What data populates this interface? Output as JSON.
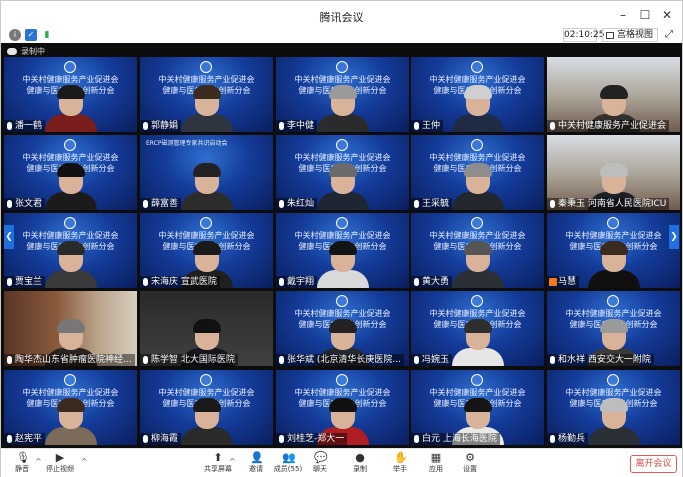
{
  "window": {
    "title": "腾讯会议",
    "minimize": "–",
    "maximize": "☐",
    "close": "✕"
  },
  "toolbar": {
    "timer": "02:10:25",
    "view_label": "宫格视图",
    "view_caret": "▾",
    "fullscreen": "⤢"
  },
  "recording": {
    "label": "录制中"
  },
  "banner": {
    "line1": "中关村健康服务产业促进会",
    "line2": "健康与医疗科技创新分会",
    "alt_line1": "ERCP磁测管理专家共识启动会"
  },
  "participants": [
    {
      "name": "潘一鹤",
      "bg": "blue",
      "hair": "#1a1a1a",
      "shirt": "#7a1d1d"
    },
    {
      "name": "郭静娟",
      "bg": "blue",
      "hair": "#3a2a1f",
      "shirt": "#2e3440"
    },
    {
      "name": "李中健",
      "bg": "blue",
      "hair": "#9a9a9a",
      "shirt": "#2b2b2b"
    },
    {
      "name": "王仲",
      "bg": "blue",
      "hair": "#cfcfcf",
      "shirt": "#1f2a44"
    },
    {
      "name": "中关村健康服务产业促进会",
      "bg": "room",
      "hair": "#222",
      "shirt": "#34302c"
    },
    {
      "name": "张文君",
      "bg": "blue",
      "hair": "#111111",
      "shirt": "#1b1b1b"
    },
    {
      "name": "薛富善",
      "bg": "blue-alt",
      "hair": "#222222",
      "shirt": "#2c2c2c"
    },
    {
      "name": "朱红灿",
      "bg": "blue",
      "hair": "#6b6b6b",
      "shirt": "#1e2533"
    },
    {
      "name": "王采毓",
      "bg": "blue",
      "hair": "#8d8d8d",
      "shirt": "#23262d"
    },
    {
      "name": "秦秉玉 河南省人民医院ICU",
      "bg": "room",
      "hair": "#bdbdbd",
      "shirt": "#1d2027"
    },
    {
      "name": "贾宝兰",
      "bg": "blue",
      "hair": "#2a2a2a",
      "shirt": "#3a3a3a"
    },
    {
      "name": "宋海庆 宣武医院",
      "bg": "blue",
      "hair": "#1a1a1a",
      "shirt": "#202020"
    },
    {
      "name": "戴宇翔",
      "bg": "blue",
      "hair": "#141414",
      "shirt": "#d9d9d9"
    },
    {
      "name": "黄大勇",
      "bg": "blue",
      "hair": "#555555",
      "shirt": "#2b2f36"
    },
    {
      "name": "马慧",
      "bg": "blue",
      "hair": "#3b2a1e",
      "shirt": "#101010"
    },
    {
      "name": "陶华杰山东省肿瘤医院神经...",
      "bg": "shelf",
      "hair": "#777777",
      "shirt": "#2a2320"
    },
    {
      "name": "陈学智 北大国际医院",
      "bg": "dark",
      "hair": "#111111",
      "shirt": "#15171c"
    },
    {
      "name": "张华斌 (北京清华长庚医院...",
      "bg": "blue",
      "hair": "#222222",
      "shirt": "#23272f"
    },
    {
      "name": "冯婉玉",
      "bg": "blue",
      "hair": "#2e2e2e",
      "shirt": "#e6e6e6"
    },
    {
      "name": "和水祥 西安交大一附院",
      "bg": "blue",
      "hair": "#9a9a9a",
      "shirt": "#3b3b3b"
    },
    {
      "name": "赵宪平",
      "bg": "blue",
      "hair": "#3a2a20",
      "shirt": "#7d6b5a"
    },
    {
      "name": "柳海霞",
      "bg": "blue",
      "hair": "#1a1a1a",
      "shirt": "#2a2a2a"
    },
    {
      "name": "刘桂芝-郑大一",
      "bg": "blue",
      "hair": "#111111",
      "shirt": "#b01e23"
    },
    {
      "name": "白元 上海长海医院",
      "bg": "blue",
      "hair": "#151515",
      "shirt": "#e9e9e9"
    },
    {
      "name": "杨勤兵",
      "bg": "blue",
      "hair": "#bdbdbd",
      "shirt": "#2a2e35"
    }
  ],
  "controls": [
    {
      "key": "mute",
      "label": "静音",
      "icon": "🎙"
    },
    {
      "key": "video",
      "label": "停止视频",
      "icon": "▶"
    },
    {
      "key": "share",
      "label": "共享屏幕",
      "icon": "⬆"
    },
    {
      "key": "invite",
      "label": "邀请",
      "icon": "👤"
    },
    {
      "key": "members",
      "label": "成员(55)",
      "icon": "👥"
    },
    {
      "key": "chat",
      "label": "聊天",
      "icon": "💬"
    },
    {
      "key": "record",
      "label": "录制",
      "icon": "●"
    },
    {
      "key": "raise",
      "label": "举手",
      "icon": "✋"
    },
    {
      "key": "apps",
      "label": "应用",
      "icon": "▦"
    },
    {
      "key": "settings",
      "label": "设置",
      "icon": "⚙"
    }
  ],
  "leave_label": "离开会议",
  "colors": {
    "accent": "#1f6fe0",
    "leave": "#e04848",
    "mic_host": "#f07a1b"
  }
}
